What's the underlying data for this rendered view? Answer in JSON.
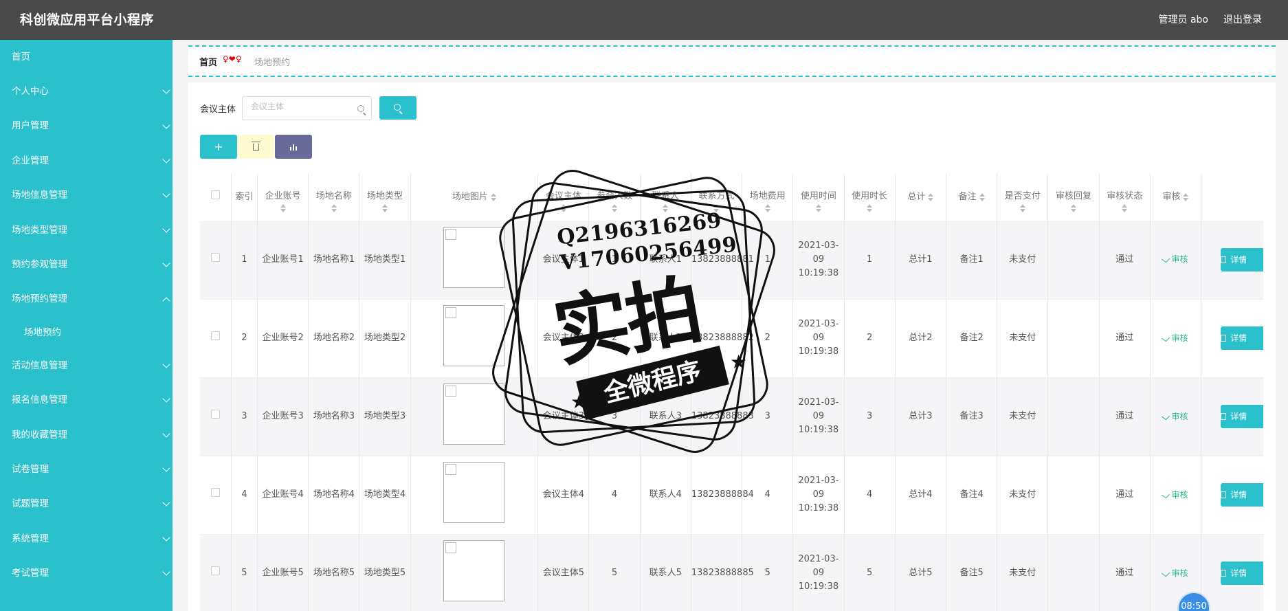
{
  "header": {
    "title": "科创微应用平台小程序",
    "user": "管理员 abo",
    "logout": "退出登录"
  },
  "sidebar": {
    "items": [
      {
        "label": "首页",
        "chevron": "none"
      },
      {
        "label": "个人中心",
        "chevron": "down"
      },
      {
        "label": "用户管理",
        "chevron": "down"
      },
      {
        "label": "企业管理",
        "chevron": "down"
      },
      {
        "label": "场地信息管理",
        "chevron": "down"
      },
      {
        "label": "场地类型管理",
        "chevron": "down"
      },
      {
        "label": "预约参观管理",
        "chevron": "down"
      },
      {
        "label": "场地预约管理",
        "chevron": "up"
      },
      {
        "label": "场地预约",
        "chevron": "sub"
      },
      {
        "label": "活动信息管理",
        "chevron": "down"
      },
      {
        "label": "报名信息管理",
        "chevron": "down"
      },
      {
        "label": "我的收藏管理",
        "chevron": "down"
      },
      {
        "label": "试卷管理",
        "chevron": "down"
      },
      {
        "label": "试题管理",
        "chevron": "down"
      },
      {
        "label": "系统管理",
        "chevron": "down"
      },
      {
        "label": "考试管理",
        "chevron": "down"
      }
    ]
  },
  "breadcrumb": {
    "home": "首页",
    "separator": "♀❤♀",
    "current": "场地预约"
  },
  "search": {
    "label": "会议主体",
    "placeholder": "会议主体"
  },
  "table": {
    "headers": [
      "索引",
      "企业账号",
      "场地名称",
      "场地类型",
      "场地图片",
      "会议主体",
      "参会人数",
      "联系人",
      "联系方式",
      "场地费用",
      "使用时间",
      "使用时长",
      "总计",
      "备注",
      "是否支付",
      "审核回复",
      "审核状态",
      "审核"
    ],
    "rows": [
      {
        "index": "1",
        "account": "企业账号1",
        "venue": "场地名称1",
        "type": "场地类型1",
        "subject": "会议主体1",
        "people": "1",
        "contact": "联系人1",
        "phone": "13823888881",
        "fee": "1",
        "time": "2021-03-09 10:19:38",
        "duration": "1",
        "total": "总计1",
        "remark": "备注1",
        "paid": "未支付",
        "reply": "",
        "status": "通过",
        "audit": "审核",
        "detail": "详情"
      },
      {
        "index": "2",
        "account": "企业账号2",
        "venue": "场地名称2",
        "type": "场地类型2",
        "subject": "会议主体2",
        "people": "2",
        "contact": "联系人2",
        "phone": "13823888882",
        "fee": "2",
        "time": "2021-03-09 10:19:38",
        "duration": "2",
        "total": "总计2",
        "remark": "备注2",
        "paid": "未支付",
        "reply": "",
        "status": "通过",
        "audit": "审核",
        "detail": "详情"
      },
      {
        "index": "3",
        "account": "企业账号3",
        "venue": "场地名称3",
        "type": "场地类型3",
        "subject": "会议主体3",
        "people": "3",
        "contact": "联系人3",
        "phone": "13823888883",
        "fee": "3",
        "time": "2021-03-09 10:19:38",
        "duration": "3",
        "total": "总计3",
        "remark": "备注3",
        "paid": "未支付",
        "reply": "",
        "status": "通过",
        "audit": "审核",
        "detail": "详情"
      },
      {
        "index": "4",
        "account": "企业账号4",
        "venue": "场地名称4",
        "type": "场地类型4",
        "subject": "会议主体4",
        "people": "4",
        "contact": "联系人4",
        "phone": "13823888884",
        "fee": "4",
        "time": "2021-03-09 10:19:38",
        "duration": "4",
        "total": "总计4",
        "remark": "备注4",
        "paid": "未支付",
        "reply": "",
        "status": "通过",
        "audit": "审核",
        "detail": "详情"
      },
      {
        "index": "5",
        "account": "企业账号5",
        "venue": "场地名称5",
        "type": "场地类型5",
        "subject": "会议主体5",
        "people": "5",
        "contact": "联系人5",
        "phone": "13823888885",
        "fee": "5",
        "time": "2021-03-09 10:19:38",
        "duration": "5",
        "total": "总计5",
        "remark": "备注5",
        "paid": "未支付",
        "reply": "",
        "status": "通过",
        "audit": "审核",
        "detail": "详情"
      }
    ]
  },
  "watermark": {
    "line1": "Q2196316269",
    "line2": "V17060256499",
    "big": "实拍",
    "ribbon": "全微程序"
  },
  "clock": "08:50",
  "colors": {
    "header_bg": "#494949",
    "sidebar_bg": "#2ac0cc",
    "accent": "#2ac0cc",
    "chart_btn": "#6a6a9a",
    "delete_btn": "#fffbd0",
    "audit_link": "#2ab88a"
  }
}
